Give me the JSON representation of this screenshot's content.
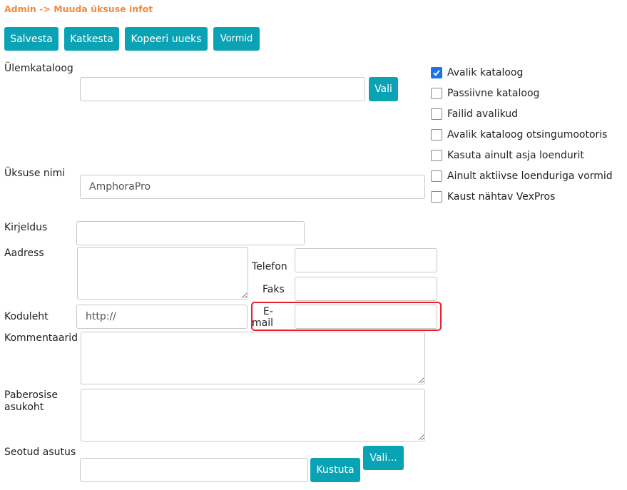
{
  "breadcrumb": "Admin -> Muuda üksuse infot",
  "toolbar": {
    "save": "Salvesta",
    "cancel": "Katkesta",
    "copy": "Kopeeri uueks",
    "forms": "Vormid"
  },
  "parent_catalog": {
    "label": "Ülemkataloog",
    "value": "",
    "choose": "Vali"
  },
  "unit_name": {
    "label": "Üksuse nimi",
    "value": "AmphoraPro"
  },
  "description": {
    "label": "Kirjeldus",
    "value": ""
  },
  "address": {
    "label": "Aadress",
    "value": ""
  },
  "phone": {
    "label": "Telefon",
    "value": ""
  },
  "fax": {
    "label": "Faks",
    "value": ""
  },
  "homepage": {
    "label": "Koduleht",
    "value": "http://"
  },
  "email": {
    "label_1": "E-",
    "label_2": "mail",
    "value": ""
  },
  "comments": {
    "label": "Kommentaarid",
    "value": ""
  },
  "paper_location": {
    "label_1": "Paberosise",
    "label_2": "asukoht",
    "value": ""
  },
  "related_institution": {
    "label": "Seotud asutus",
    "value": "",
    "delete": "Kustuta",
    "choose": "Vali..."
  },
  "options": [
    {
      "label": "Avalik kataloog",
      "checked": true
    },
    {
      "label": "Passiivne kataloog",
      "checked": false
    },
    {
      "label": "Failid avalikud",
      "checked": false
    },
    {
      "label": "Avalik kataloog otsingumootoris",
      "checked": false
    },
    {
      "label": "Kasuta ainult asja loendurit",
      "checked": false
    },
    {
      "label": "Ainult aktiivse loenduriga vormid",
      "checked": false
    },
    {
      "label": "Kaust nähtav VexPros",
      "checked": false
    }
  ],
  "colors": {
    "accent": "#0aa3b5",
    "breadcrumb": "#f08a3c",
    "highlight": "#e8202a",
    "checkbox_checked": "#1a73e8"
  }
}
